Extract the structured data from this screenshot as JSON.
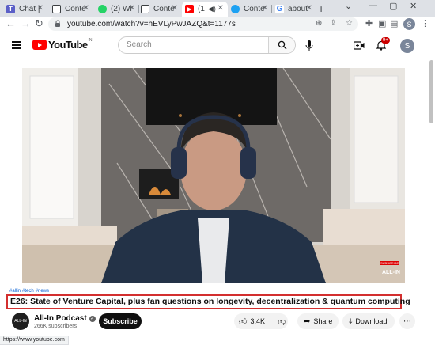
{
  "browser": {
    "tabs": [
      {
        "label": "Chat |",
        "favicon_color": "#5b5fc7"
      },
      {
        "label": "Conte",
        "favicon_color": "#3c4043"
      },
      {
        "label": "(2) Wi",
        "favicon_color": "#25d366"
      },
      {
        "label": "Conte",
        "favicon_color": "#3c4043"
      },
      {
        "label": "(1",
        "favicon_color": "#ff0000"
      },
      {
        "label": "Conte",
        "favicon_color": "#1da1f2"
      },
      {
        "label": "about",
        "favicon_color": "#4285f4"
      }
    ],
    "url": "youtube.com/watch?v=hEVLyPwJAZQ&t=1177s",
    "profile_initial": "S",
    "status_url": "https://www.youtube.com"
  },
  "youtube": {
    "logo_text": "YouTube",
    "country_code": "IN",
    "search_placeholder": "Search",
    "notification_count": "9+",
    "avatar_initial": "S"
  },
  "video": {
    "overlay_subscribe": "SUBSCRIBE",
    "overlay_brand": "ALL-IN"
  },
  "meta": {
    "hashtags": [
      "#allin",
      "#tech",
      "#news"
    ],
    "title": "E26: State of Venture Capital, plus fan questions on longevity, decentralization & quantum computing",
    "channel_name": "All-In Podcast",
    "channel_avatar_text": "ALL-IN",
    "subscribers": "266K subscribers",
    "subscribe_label": "Subscribe",
    "like_count": "3.4K",
    "share_label": "Share",
    "download_label": "Download"
  },
  "colors": {
    "accent_red": "#ff0000",
    "title_outline": "#d32f2f",
    "link_blue": "#065fd4"
  }
}
